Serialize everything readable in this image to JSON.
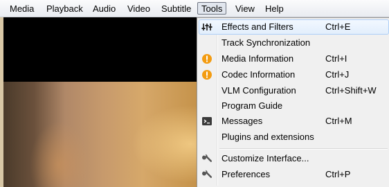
{
  "menubar": {
    "items": [
      "Media",
      "Playback",
      "Audio",
      "Video",
      "Subtitle",
      "Tools",
      "View",
      "Help"
    ],
    "active": "Tools"
  },
  "tools_menu": {
    "items": [
      {
        "label": "Effects and Filters",
        "shortcut": "Ctrl+E",
        "icon": "equalizer-icon"
      },
      {
        "label": "Track Synchronization",
        "shortcut": "",
        "icon": ""
      },
      {
        "label": "Media Information",
        "shortcut": "Ctrl+I",
        "icon": "info-icon"
      },
      {
        "label": "Codec Information",
        "shortcut": "Ctrl+J",
        "icon": "info-icon"
      },
      {
        "label": "VLM Configuration",
        "shortcut": "Ctrl+Shift+W",
        "icon": ""
      },
      {
        "label": "Program Guide",
        "shortcut": "",
        "icon": ""
      },
      {
        "label": "Messages",
        "shortcut": "Ctrl+M",
        "icon": "terminal-icon"
      },
      {
        "label": "Plugins and extensions",
        "shortcut": "",
        "icon": ""
      },
      {
        "label": "Customize Interface...",
        "shortcut": "",
        "icon": "wrench-icon"
      },
      {
        "label": "Preferences",
        "shortcut": "Ctrl+P",
        "icon": "wrench-icon"
      }
    ]
  },
  "colors": {
    "info_icon": "#f39c12",
    "highlight_border": "#aecff7"
  }
}
